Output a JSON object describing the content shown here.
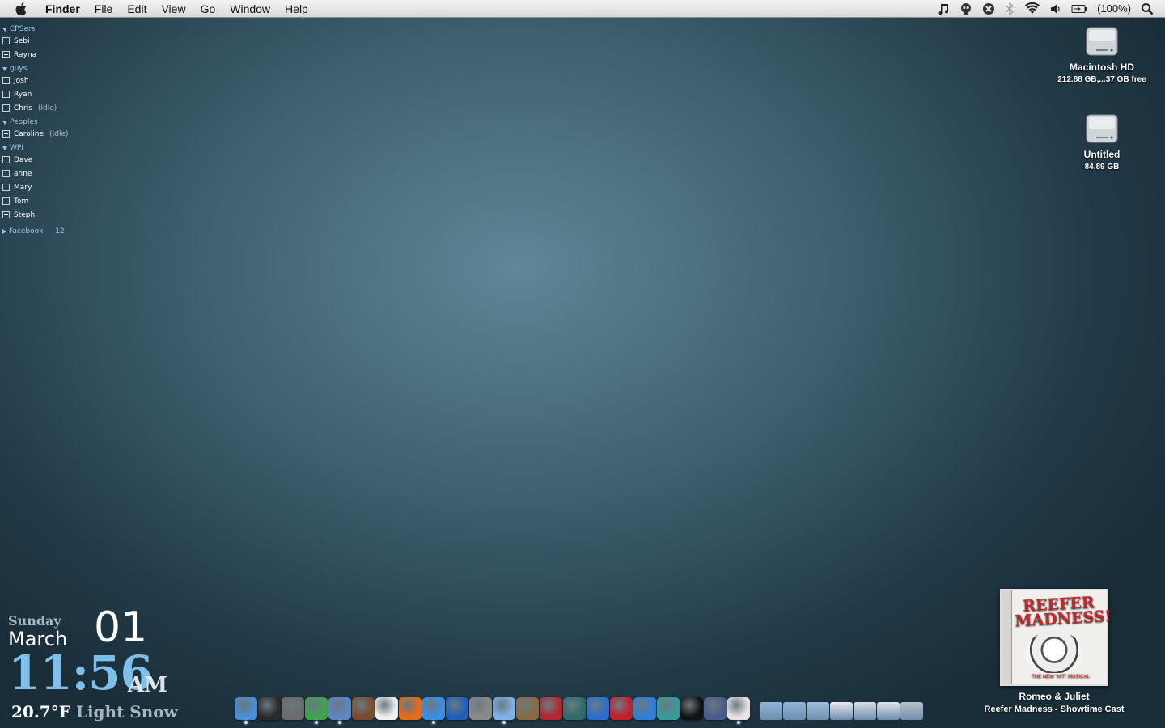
{
  "menubar": {
    "app": "Finder",
    "menus": [
      "File",
      "Edit",
      "View",
      "Go",
      "Window",
      "Help"
    ],
    "battery": "(100%)"
  },
  "buddy_list": {
    "groups": [
      {
        "name": "CPSers",
        "buddies": [
          {
            "name": "Sebi",
            "status": ""
          },
          {
            "name": "Rayna",
            "status": ""
          }
        ]
      },
      {
        "name": "guys",
        "buddies": [
          {
            "name": "Josh",
            "status": ""
          },
          {
            "name": "Ryan",
            "status": ""
          },
          {
            "name": "Chris",
            "status": "(Idle)"
          }
        ]
      },
      {
        "name": "Peoples",
        "buddies": [
          {
            "name": "Caroline",
            "status": "(Idle)"
          }
        ]
      },
      {
        "name": "WPI",
        "buddies": [
          {
            "name": "Dave",
            "status": ""
          },
          {
            "name": "anne",
            "status": ""
          },
          {
            "name": "Mary",
            "status": ""
          },
          {
            "name": "Tom",
            "status": ""
          },
          {
            "name": "Steph",
            "status": ""
          }
        ]
      }
    ],
    "facebook": {
      "name": "Facebook",
      "count": "12"
    }
  },
  "drives": [
    {
      "name": "Macintosh HD",
      "info": "212.88 GB,...37 GB free"
    },
    {
      "name": "Untitled",
      "info": "84.89 GB"
    }
  ],
  "clock": {
    "day": "Sunday",
    "month": "March",
    "date": "01",
    "time": "11:56",
    "ampm": "AM",
    "temp": "20.7°F",
    "condition": "Light Snow"
  },
  "now_playing": {
    "album_title": "REEFER MADNESS!",
    "album_sub": "THE NEW \"HIT\" MUSICAL",
    "song": "Romeo & Juliet",
    "artist_album": "Reefer Madness - Showtime Cast"
  },
  "dock": {
    "apps": [
      {
        "name": "finder-icon",
        "color": "#4a8fd8",
        "running": true
      },
      {
        "name": "dashboard-icon",
        "color": "#2b2b2b",
        "running": false
      },
      {
        "name": "expose-icon",
        "color": "#6b6b6b",
        "running": false
      },
      {
        "name": "adium-icon",
        "color": "#3fa34d",
        "running": true
      },
      {
        "name": "mail-icon",
        "color": "#5c86c4",
        "running": true
      },
      {
        "name": "photo-booth-icon",
        "color": "#7a4a2a",
        "running": false
      },
      {
        "name": "ical-icon",
        "color": "#f0f0f0",
        "running": false
      },
      {
        "name": "firefox-icon",
        "color": "#e76b14",
        "running": false
      },
      {
        "name": "safari-icon",
        "color": "#3a8ee6",
        "running": true
      },
      {
        "name": "google-earth-icon",
        "color": "#1f5fb8",
        "running": false
      },
      {
        "name": "iphoto-icon",
        "color": "#8a8a8a",
        "running": false
      },
      {
        "name": "itunes-icon",
        "color": "#7db2e8",
        "running": true
      },
      {
        "name": "aperture-icon",
        "color": "#8b6a42",
        "running": false
      },
      {
        "name": "flashcard-icon",
        "color": "#b3262b",
        "running": false
      },
      {
        "name": "time-machine-icon",
        "color": "#2f6b6b",
        "running": false
      },
      {
        "name": "wiki-icon",
        "color": "#2a6fd0",
        "running": false
      },
      {
        "name": "star-4-icon",
        "color": "#c0202a",
        "running": false
      },
      {
        "name": "blitzmax-icon",
        "color": "#2d7fd8",
        "running": false
      },
      {
        "name": "cyberduck-icon",
        "color": "#3a9a9a",
        "running": false
      },
      {
        "name": "steam-icon",
        "color": "#111111",
        "running": false
      },
      {
        "name": "game-icon",
        "color": "#4a5a8a",
        "running": false
      },
      {
        "name": "preview-icon",
        "color": "#e8e2e6",
        "running": true
      }
    ],
    "stacks": [
      {
        "name": "applications-folder-icon",
        "color": "#8fb4d8"
      },
      {
        "name": "documents-folder-icon",
        "color": "#8fb4d8"
      },
      {
        "name": "downloads-folder-icon",
        "color": "#9fbfdf"
      },
      {
        "name": "document-stack-icon",
        "color": "#e8eaec"
      },
      {
        "name": "screenshot-stack-icon",
        "color": "#d8dde2"
      },
      {
        "name": "file-stack-icon",
        "color": "#dfe4ea"
      },
      {
        "name": "trash-icon",
        "color": "#b8c0c6"
      }
    ]
  }
}
